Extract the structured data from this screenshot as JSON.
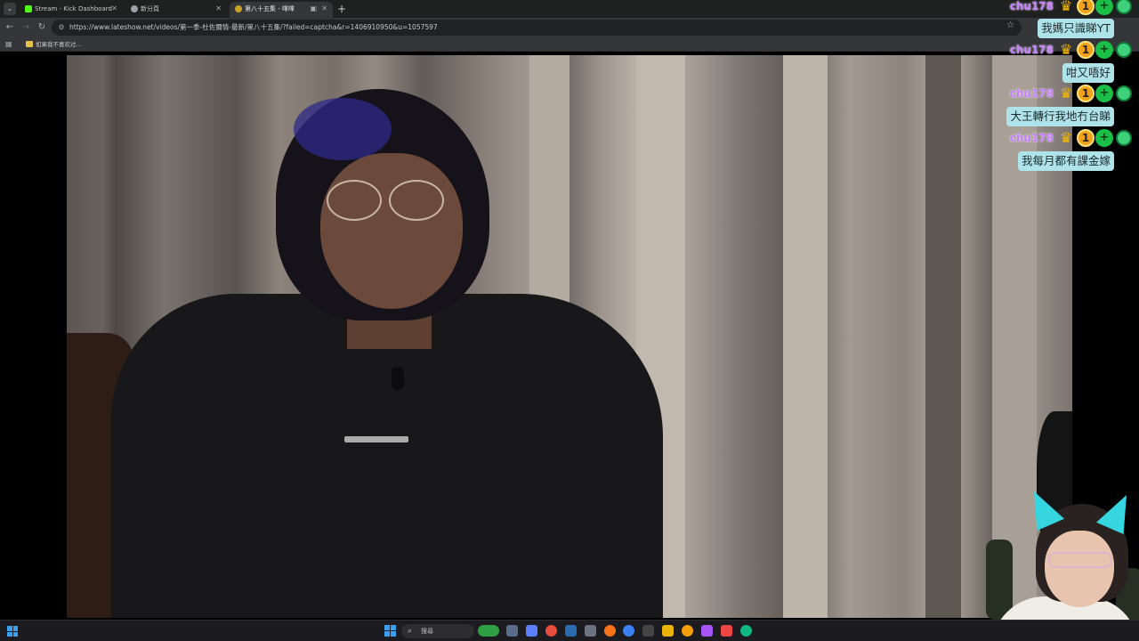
{
  "browser": {
    "tabs": [
      {
        "label": "Stream - Kick Dashboard",
        "favicon_color": "#53fc18"
      },
      {
        "label": "新分頁",
        "favicon_color": "#9aa0a6"
      },
      {
        "label": "第八十五集 - 嗱嗱",
        "favicon_color": "#c9a227"
      }
    ],
    "new_tab": "+",
    "url": "https://www.lateshow.net/videos/第一季-杜佐爾情-最新/第八十五集/?failed=captcha&r=1406910950&u=1057597",
    "bookmark": "如果我不喜欢过…"
  },
  "chat": {
    "username": "chu178",
    "badge_one": "1",
    "badge_plus": "+",
    "messages": [
      "我媽只識睇YT",
      "咁又唔好",
      "大王轉行我地冇台睇",
      "我每月都有課金嫁"
    ]
  },
  "taskbar": {
    "search_label": "搜尋",
    "app_colors": [
      "#2ea043",
      "#5b7fff",
      "#e74c3c",
      "#f39c12",
      "#3b82f6",
      "#eab308",
      "#a855f7",
      "#ef4444",
      "#f97316"
    ]
  }
}
